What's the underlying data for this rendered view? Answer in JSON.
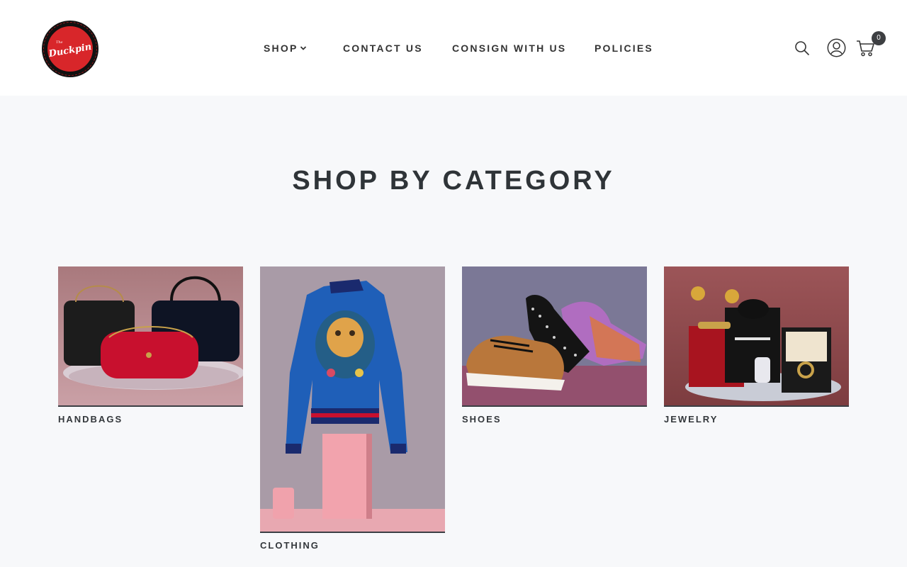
{
  "brand": {
    "logo_name": "The Duckpin Consignment Adventure",
    "logo_script": "Duckpin",
    "logo_the": "The",
    "logo_ring_text": "CONSIGNMENT ADVENTURE"
  },
  "nav": {
    "items": [
      {
        "label": "SHOP",
        "has_dropdown": true
      },
      {
        "label": "CONTACT US"
      },
      {
        "label": "CONSIGN WITH US"
      },
      {
        "label": "POLICIES"
      }
    ]
  },
  "header_icons": {
    "search": "search-icon",
    "account": "account-icon",
    "cart": "cart-icon",
    "cart_count": "0"
  },
  "section": {
    "title": "SHOP BY CATEGORY"
  },
  "categories": [
    {
      "label": "HANDBAGS",
      "image": "handbags-photo",
      "bg": "#b58a90"
    },
    {
      "label": "CLOTHING",
      "image": "clothing-photo",
      "bg": "#a89aa6"
    },
    {
      "label": "SHOES",
      "image": "shoes-photo",
      "bg": "#7a7694"
    },
    {
      "label": "JEWELRY",
      "image": "jewelry-photo",
      "bg": "#8c4d4f"
    }
  ],
  "colors": {
    "header_bg": "#ffffff",
    "page_bg": "#f7f8fa",
    "text": "#2f3337",
    "logo_red": "#d8262a",
    "badge": "#3d3f42"
  }
}
